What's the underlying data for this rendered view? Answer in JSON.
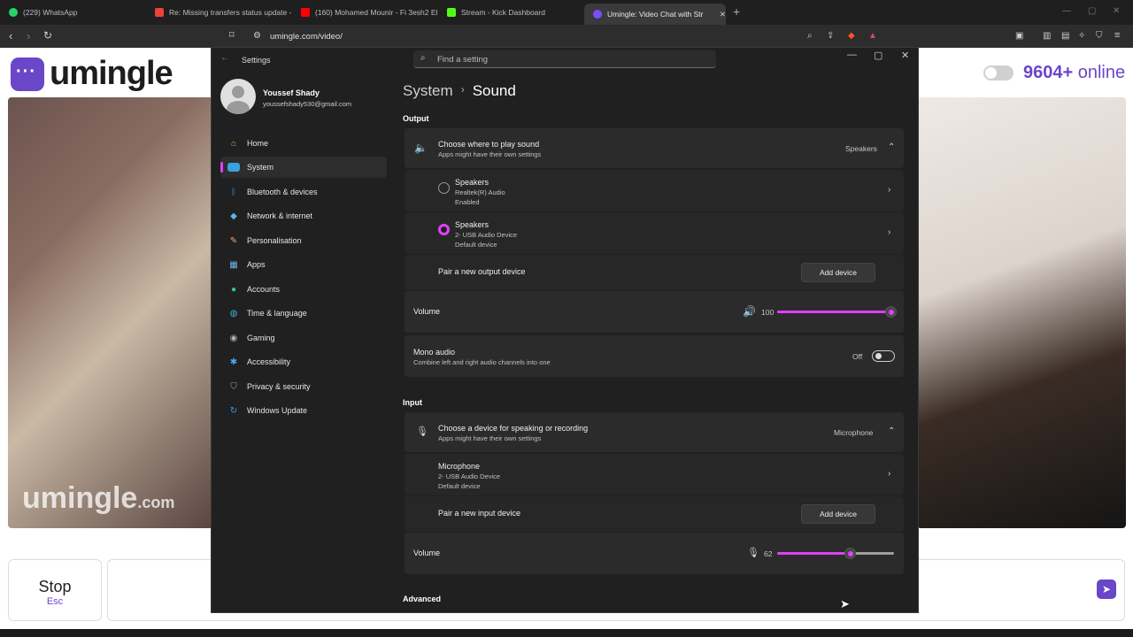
{
  "browser": {
    "tabs": [
      {
        "title": "(229) WhatsApp",
        "icon": "whatsapp-icon",
        "color": "#25d366"
      },
      {
        "title": "Re: Missing transfers status update -",
        "icon": "gmail-icon",
        "color": "#ea4335"
      },
      {
        "title": "(160) Mohamed Mounir - Fi 3esh2 El",
        "icon": "youtube-icon",
        "color": "#ff0000"
      },
      {
        "title": "Stream - Kick Dashboard",
        "icon": "kick-icon",
        "color": "#53fc18"
      },
      {
        "title": "Umingle: Video Chat with Str",
        "icon": "umingle-icon",
        "color": "#7c4dff"
      }
    ],
    "url": "umingle.com/video/"
  },
  "site": {
    "logo_text": "umingle",
    "online_count": "9604+",
    "online_label": "online",
    "watermark": "umingle",
    "watermark_suffix": ".com",
    "stop_label": "Stop",
    "stop_hint": "Esc",
    "accent": "#6a46c9"
  },
  "settings": {
    "window_title": "Settings",
    "search_placeholder": "Find a setting",
    "profile": {
      "name": "Youssef Shady",
      "email": "youssefshady530@gmail.com"
    },
    "nav": [
      {
        "label": "Home",
        "icon": "home-icon",
        "color": "#f0a34a"
      },
      {
        "label": "System",
        "icon": "system-icon",
        "color": "#3aa0e0",
        "selected": true
      },
      {
        "label": "Bluetooth & devices",
        "icon": "bluetooth-icon",
        "color": "#2b8ee6"
      },
      {
        "label": "Network & internet",
        "icon": "network-icon",
        "color": "#5ab6f0"
      },
      {
        "label": "Personalisation",
        "icon": "brush-icon",
        "color": "#f0a070"
      },
      {
        "label": "Apps",
        "icon": "apps-icon",
        "color": "#6fb6e8"
      },
      {
        "label": "Accounts",
        "icon": "accounts-icon",
        "color": "#3fc48a"
      },
      {
        "label": "Time & language",
        "icon": "globe-icon",
        "color": "#4aa8e0"
      },
      {
        "label": "Gaming",
        "icon": "gaming-icon",
        "color": "#b0b0b0"
      },
      {
        "label": "Accessibility",
        "icon": "accessibility-icon",
        "color": "#4aa8f0"
      },
      {
        "label": "Privacy & security",
        "icon": "shield-icon",
        "color": "#a0a0a0"
      },
      {
        "label": "Windows Update",
        "icon": "update-icon",
        "color": "#3b9be8"
      }
    ],
    "breadcrumb": {
      "parent": "System",
      "current": "Sound"
    },
    "output": {
      "section": "Output",
      "choose_title": "Choose where to play sound",
      "choose_sub": "Apps might have their own settings",
      "choose_value": "Speakers",
      "devices": [
        {
          "name": "Speakers",
          "line1": "Realtek(R) Audio",
          "line2": "Enabled",
          "selected": false
        },
        {
          "name": "Speakers",
          "line1": "2- USB Audio Device",
          "line2": "Default device",
          "selected": true
        }
      ],
      "pair_label": "Pair a new output device",
      "add_label": "Add device",
      "volume_label": "Volume",
      "volume_value": "100",
      "volume_level": 100,
      "mono_title": "Mono audio",
      "mono_sub": "Combine left and right audio channels into one",
      "mono_state": "Off"
    },
    "input": {
      "section": "Input",
      "choose_title": "Choose a device for speaking or recording",
      "choose_sub": "Apps might have their own settings",
      "choose_value": "Microphone",
      "device": {
        "name": "Microphone",
        "line1": "2- USB Audio Device",
        "line2": "Default device"
      },
      "pair_label": "Pair a new input device",
      "add_label": "Add device",
      "volume_label": "Volume",
      "volume_value": "62",
      "volume_level": 62
    },
    "advanced_section": "Advanced",
    "accent": "#e040fb"
  }
}
